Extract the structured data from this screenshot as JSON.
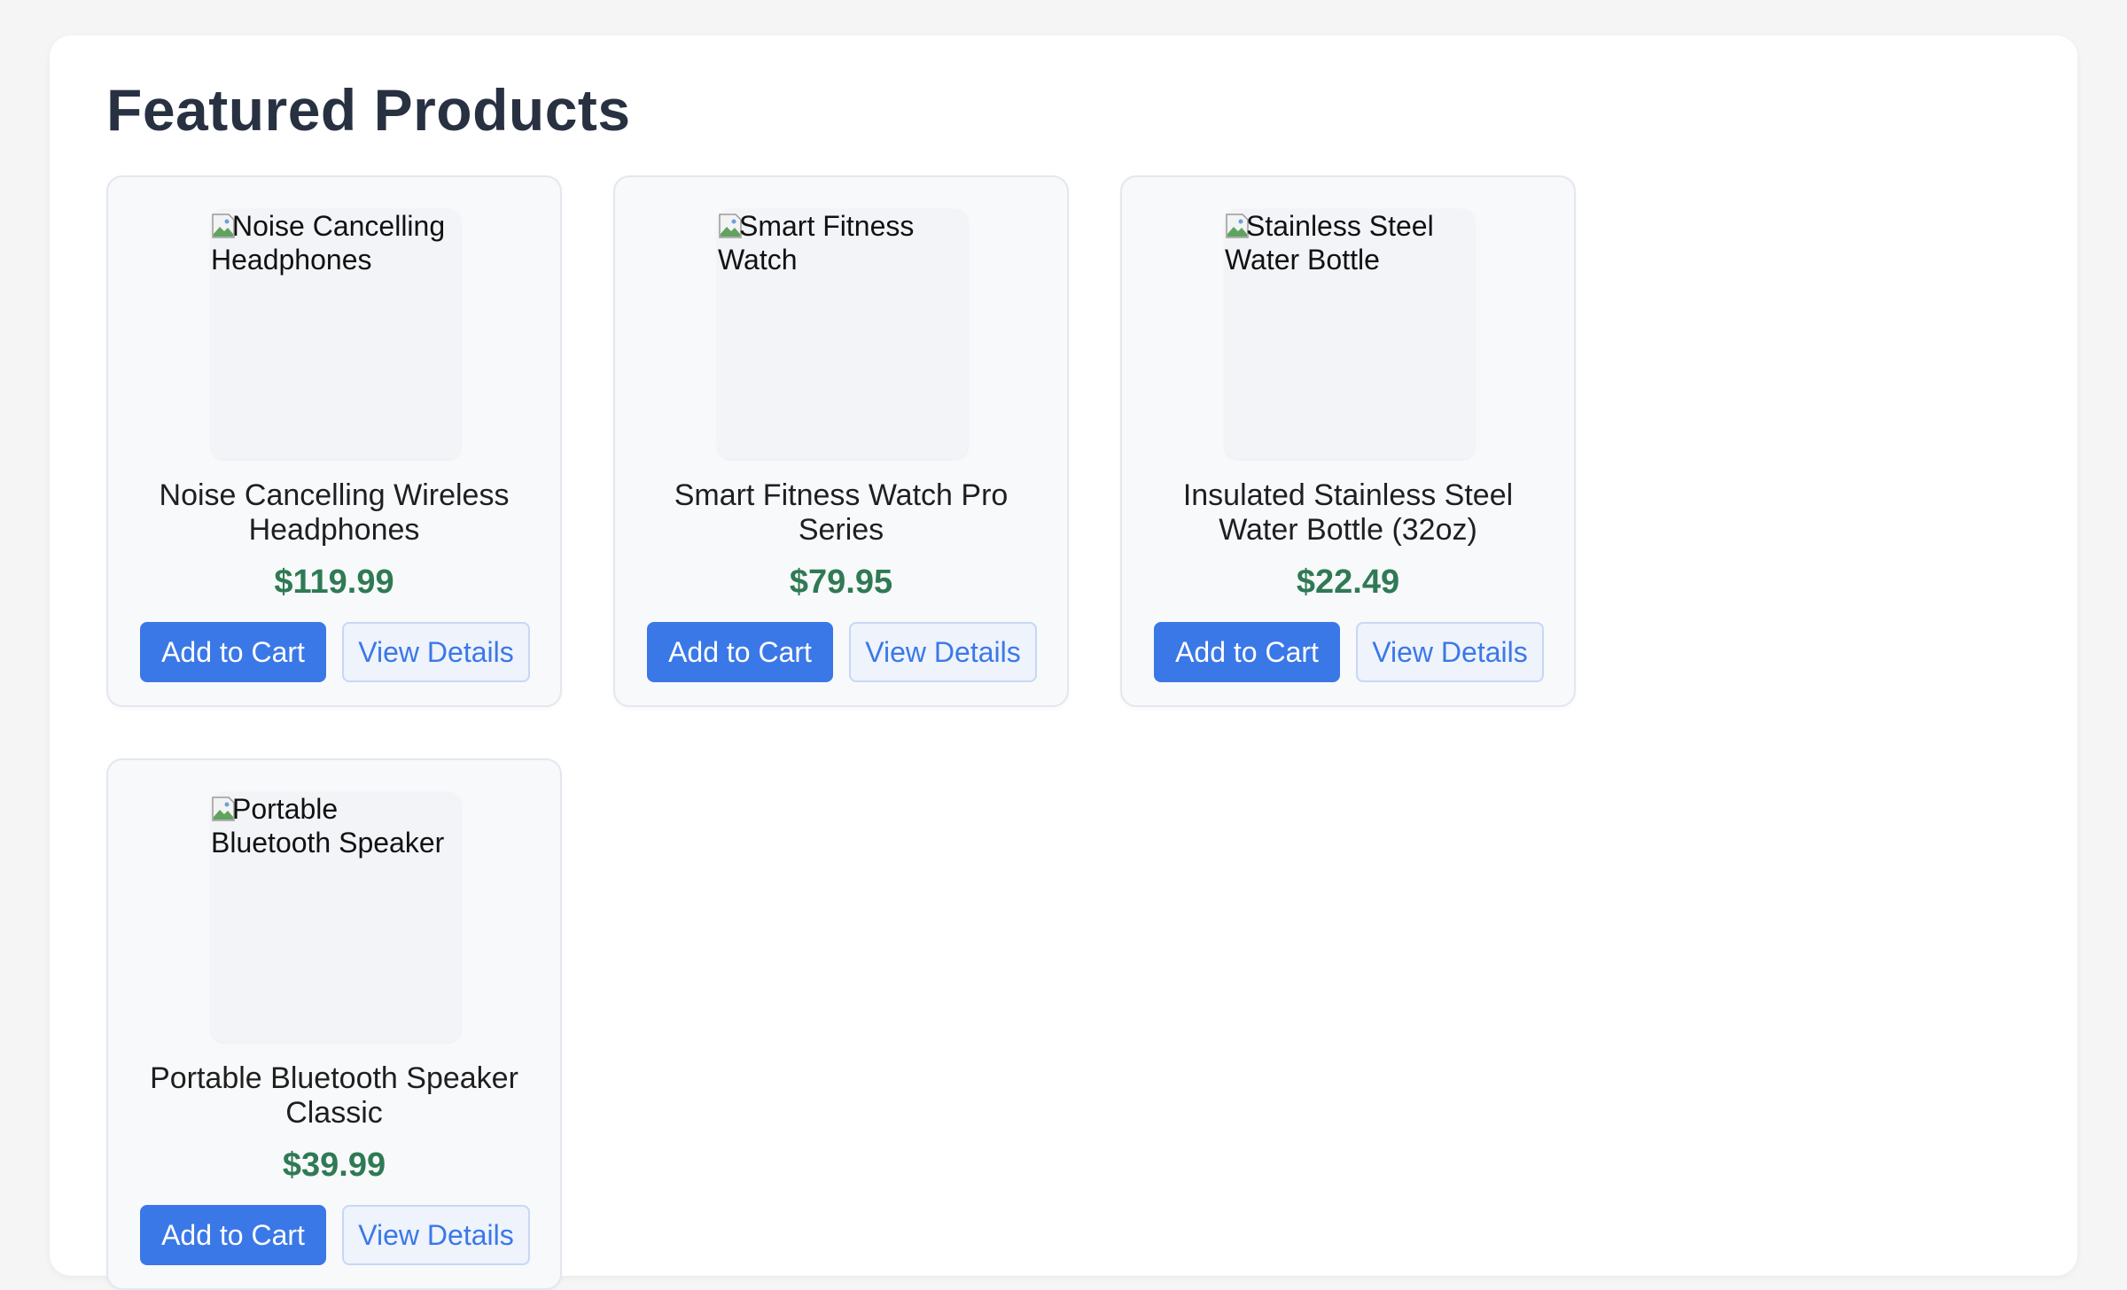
{
  "page": {
    "title": "Featured Products"
  },
  "colors": {
    "accent": "#3b78e7",
    "price": "#2f7a54",
    "heading": "#283141"
  },
  "products": [
    {
      "image_alt": "Noise Cancelling Headphones",
      "name": "Noise Cancelling Wireless Headphones",
      "price": "$119.99",
      "add_label": "Add to Cart",
      "details_label": "View Details"
    },
    {
      "image_alt": "Smart Fitness Watch",
      "name": "Smart Fitness Watch Pro Series",
      "price": "$79.95",
      "add_label": "Add to Cart",
      "details_label": "View Details"
    },
    {
      "image_alt": "Stainless Steel Water Bottle",
      "name": "Insulated Stainless Steel Water Bottle (32oz)",
      "price": "$22.49",
      "add_label": "Add to Cart",
      "details_label": "View Details"
    },
    {
      "image_alt": "Portable Bluetooth Speaker",
      "name": "Portable Bluetooth Speaker Classic",
      "price": "$39.99",
      "add_label": "Add to Cart",
      "details_label": "View Details"
    }
  ]
}
